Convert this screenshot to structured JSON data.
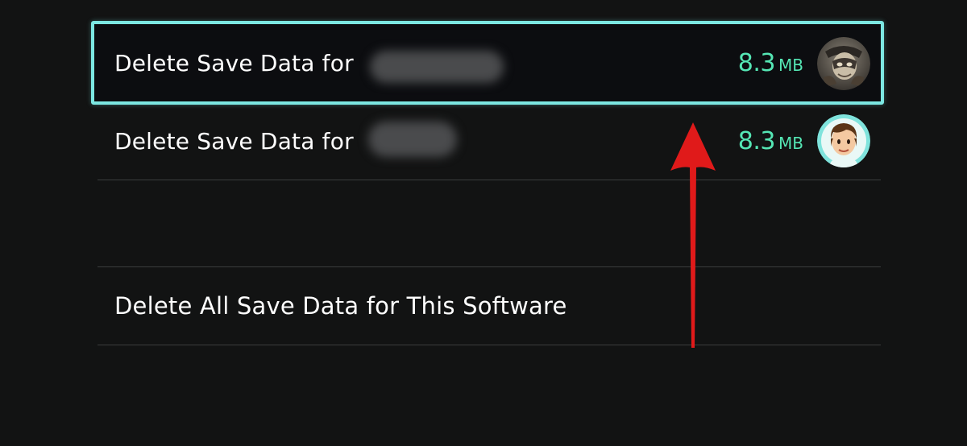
{
  "save_data_list": {
    "users": [
      {
        "label": "Delete Save Data for",
        "size_value": "8.3",
        "size_unit": "MB",
        "avatar": "masked-character-avatar",
        "selected": true
      },
      {
        "label": "Delete Save Data for",
        "size_value": "8.3",
        "size_unit": "MB",
        "avatar": "mii-avatar",
        "selected": false
      }
    ],
    "delete_all_label": "Delete All Save Data for This Software"
  },
  "colors": {
    "background": "#121313",
    "focus_border": "#7ce7e2",
    "size_text": "#55e6b4",
    "divider": "#3b3d3d",
    "annotation_arrow": "#e01a1a"
  },
  "annotation": {
    "icon": "red-up-arrow-icon"
  }
}
